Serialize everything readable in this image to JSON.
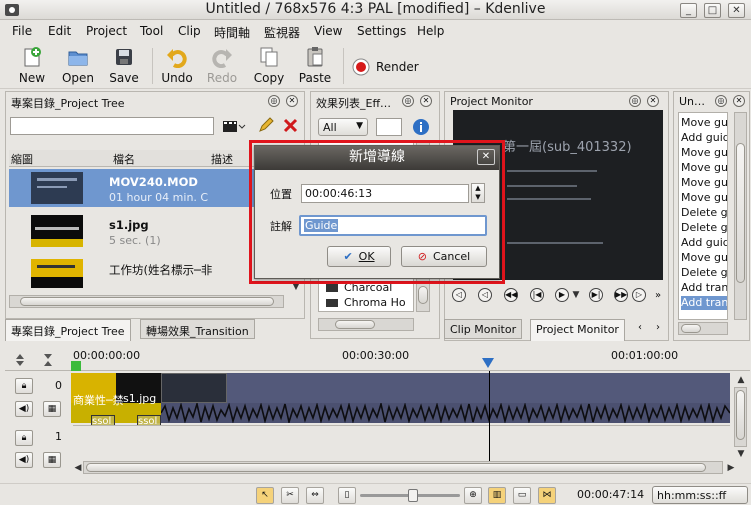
{
  "window": {
    "title": "Untitled / 768x576 4:3 PAL [modified]  –  Kdenlive",
    "minimize": "_",
    "maximize": "□",
    "close": "✕"
  },
  "menu": [
    "File",
    "Edit",
    "Project",
    "Tool",
    "Clip",
    "時間軸",
    "監視器",
    "View",
    "Settings",
    "Help"
  ],
  "toolbar": {
    "new": "New",
    "open": "Open",
    "save": "Save",
    "undo": "Undo",
    "redo": "Redo",
    "copy": "Copy",
    "paste": "Paste",
    "render": "Render"
  },
  "project_tree": {
    "title": "專案目錄_Project Tree",
    "columns": [
      "縮圖",
      "檔名",
      "描述"
    ],
    "items": [
      {
        "name": "MOV240.MOD",
        "info": "01 hour 04 min. C"
      },
      {
        "name": "s1.jpg",
        "info": "5 sec. (1)"
      },
      {
        "name": "工作坊(姓名標示─非",
        "info": ""
      }
    ],
    "tab1": "專案目錄_Project Tree",
    "tab2": "轉場效果_Transition"
  },
  "effects": {
    "title": "效果列表_Eff…",
    "filter": "All",
    "items": [
      "Charcoal",
      "Chroma Ho"
    ]
  },
  "monitor": {
    "title": "Project Monitor",
    "overlay_text": "第一屆(sub_401332)",
    "tab_clip": "Clip Monitor",
    "tab_project": "Project Monitor"
  },
  "undo": {
    "title": "Un…",
    "items": [
      "Move gu",
      "Add guid",
      "Move gu",
      "Move gu",
      "Move gu",
      "Move gu",
      "Delete g",
      "Delete g",
      "Add guid",
      "Move gu",
      "Delete g",
      "Add tran",
      "Add tran"
    ]
  },
  "timeline": {
    "ruler": [
      "00:00:00:00",
      "00:00:30:00",
      "00:01:00:00"
    ],
    "track1_label": "0",
    "track2_label": "1",
    "clip_labels": [
      "商業性─禁",
      "s1.jpg"
    ],
    "transition_label": "ssol"
  },
  "status": {
    "timecode": "00:00:47:14",
    "format": "hh:mm:ss::ff"
  },
  "dialog": {
    "title": "新增導線",
    "position_label": "位置",
    "position_value": "00:00:46:13",
    "comment_label": "註解",
    "comment_value": "Guide",
    "ok": "OK",
    "cancel": "Cancel",
    "close": "✕"
  },
  "colors": {
    "highlight": "#e0141c",
    "selection": "#6f97cf",
    "track": "#53597a"
  }
}
